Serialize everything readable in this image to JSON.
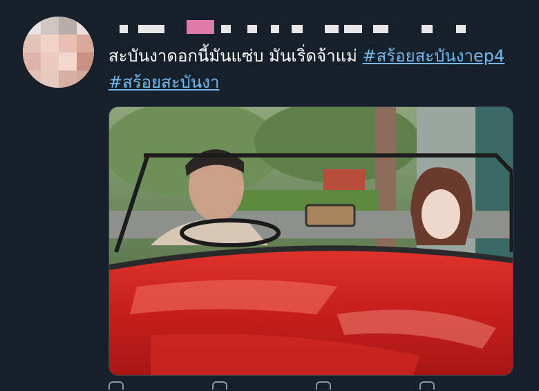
{
  "tweet": {
    "text_plain": "สะบันงาดอกนี้มันแซ่บ มันเริ่ดจ้าแม่ ",
    "hashtags": [
      "#สร้อยสะบันงาep4",
      "#สร้อยสะบันงา"
    ],
    "media": {
      "alt": ""
    }
  },
  "colors": {
    "background": "#15202b",
    "hashtag": "#74b8f0",
    "text": "#ffffff",
    "icon": "#8899a6"
  },
  "icons": [
    "reply-icon",
    "retweet-icon",
    "like-icon",
    "share-icon"
  ]
}
